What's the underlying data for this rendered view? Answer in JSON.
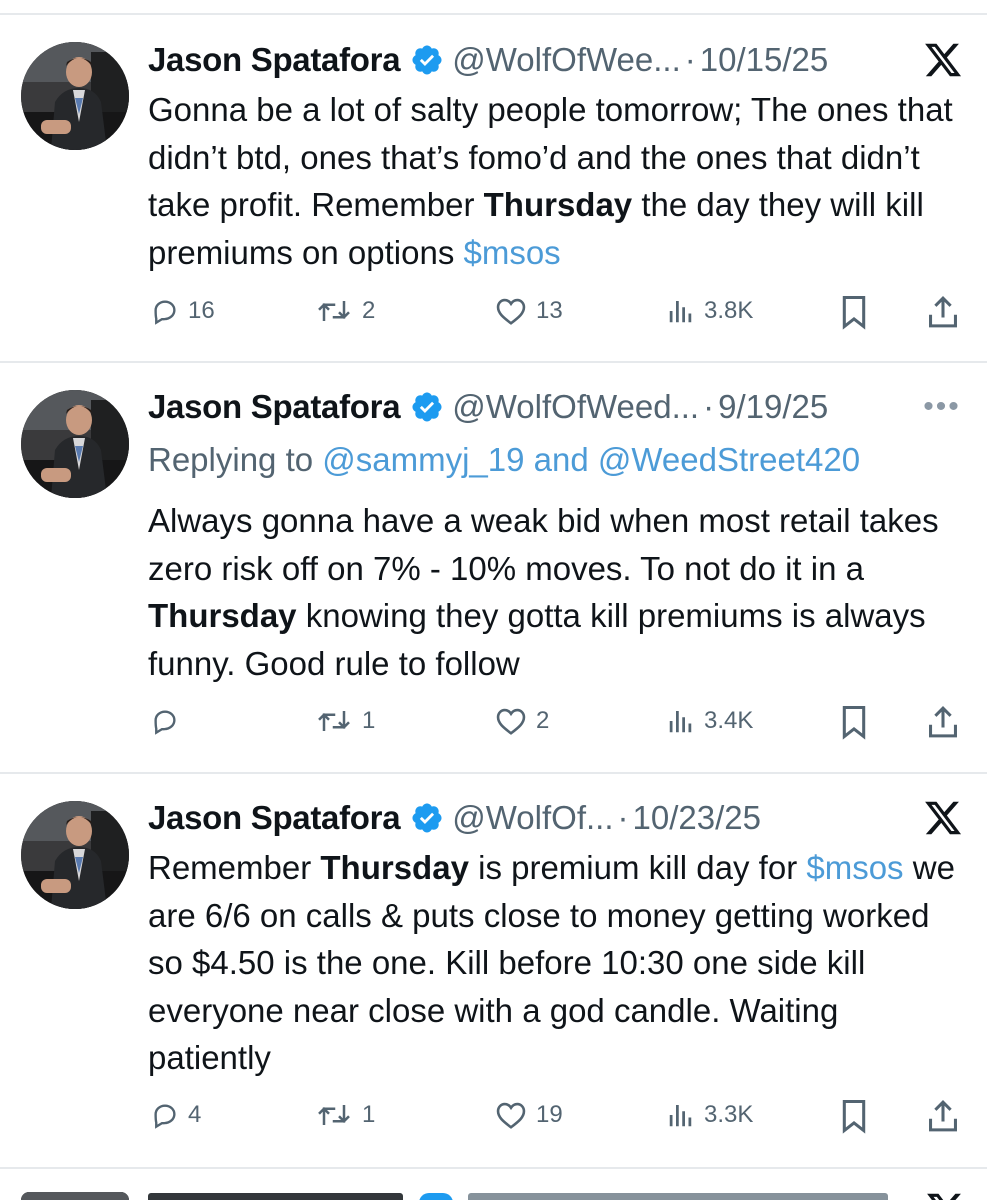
{
  "tweets": [
    {
      "author": "Jason Spatafora",
      "handle": "@WolfOfWee...",
      "date": "10/15/25",
      "corner": "x-logo-icon",
      "reply_prefix": "",
      "reply_to": "",
      "body": [
        {
          "text": "Gonna be a lot of salty people tomorrow; The ones that didn’t btd, ones that’s fomo’d and the ones that didn’t take profit. Remember ",
          "style": "normal"
        },
        {
          "text": "Thursday",
          "style": "bold"
        },
        {
          "text": " the day they will kill premiums on options ",
          "style": "normal"
        },
        {
          "text": "$msos",
          "style": "link"
        }
      ],
      "stats": {
        "replies": "16",
        "reposts": "2",
        "likes": "13",
        "views": "3.8K"
      }
    },
    {
      "author": "Jason Spatafora",
      "handle": "@WolfOfWeed...",
      "date": "9/19/25",
      "corner": "more-icon",
      "more_glyph": "•••",
      "reply_prefix": "Replying to ",
      "reply_to": "@sammyj_19 and @WeedStreet420",
      "body": [
        {
          "text": "Always gonna have a weak bid when most retail takes zero risk off on 7% - 10% moves. To not do it in a ",
          "style": "normal"
        },
        {
          "text": "Thursday",
          "style": "bold"
        },
        {
          "text": " knowing they gotta kill premiums is always funny. Good rule to follow",
          "style": "normal"
        }
      ],
      "stats": {
        "replies": "",
        "reposts": "1",
        "likes": "2",
        "views": "3.4K"
      }
    },
    {
      "author": "Jason Spatafora",
      "handle": "@WolfOf...",
      "date": "10/23/25",
      "corner": "x-logo-icon",
      "reply_prefix": "",
      "reply_to": "",
      "body": [
        {
          "text": "Remember ",
          "style": "normal"
        },
        {
          "text": "Thursday",
          "style": "bold"
        },
        {
          "text": " is premium kill day for ",
          "style": "normal"
        },
        {
          "text": "$msos",
          "style": "link"
        },
        {
          "text": " we are 6/6 on calls & puts close to money getting worked so $4.50 is the one. Kill before 10:30 one side kill everyone near close with a god candle. Waiting patiently",
          "style": "normal"
        }
      ],
      "stats": {
        "replies": "4",
        "reposts": "1",
        "likes": "19",
        "views": "3.3K"
      }
    }
  ],
  "colors": {
    "link": "#4c9bd7",
    "muted": "#536471",
    "divider": "#e6e9ec",
    "verified": "#1d9bf0"
  }
}
